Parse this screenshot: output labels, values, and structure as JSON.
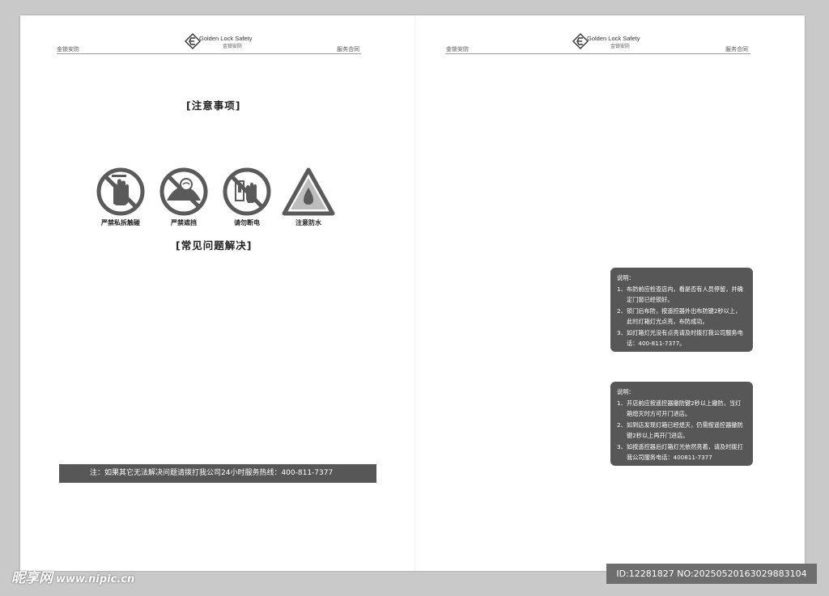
{
  "header": {
    "logo_en": "Golden Lock Safety",
    "logo_cn": "金锁安防",
    "left_text": "金锁安防",
    "right_text": "服务合同"
  },
  "left_page": {
    "notice_title": "[注意事项]",
    "signs": [
      {
        "label": "严禁私拆触碰",
        "icon": "no-touch-hand-icon"
      },
      {
        "label": "严禁遮挡",
        "icon": "no-cover-icon"
      },
      {
        "label": "请勿断电",
        "icon": "no-power-off-icon"
      },
      {
        "label": "注意防水",
        "icon": "waterproof-warning-icon"
      }
    ],
    "faq_title": "[常见问题解决]",
    "hotline_note": "注：如果其它无法解决问题请拨打我公司24小时服务热线：400-811-7377"
  },
  "right_page": {
    "box1": {
      "head": "说明：",
      "items": [
        {
          "num": "1、",
          "text": "布防前应检查店内，看是否有人员停留，并确定门窗已经锁好。"
        },
        {
          "num": "2、",
          "text": "锁门后布防，按遥控器外出布防键2秒以上，此时灯箱灯光点亮，布防成功。"
        },
        {
          "num": "3、",
          "text": "如灯箱灯光没有点亮请及时拨打我公司服务电话：400-811-7377。"
        }
      ]
    },
    "box2": {
      "head": "说明：",
      "items": [
        {
          "num": "1、",
          "text": "开店前应按遥控器撤防键2秒以上撤防，当灯箱熄灭时方可开门进店。"
        },
        {
          "num": "2、",
          "text": "如到店发现灯箱已经熄灭，仍需按遥控器撤防键2秒以上再开门进店。"
        },
        {
          "num": "3、",
          "text": "如按遥控器后灯箱灯光依然亮着，请及时拨打我公司服务电话：400811-7377"
        }
      ]
    }
  },
  "watermark": {
    "site_name": "昵享网",
    "url": "www.nipic.cn",
    "id_text": "ID:12281827 NO:20250520163029883104"
  },
  "colors": {
    "box_fill": "#575757",
    "sign_gray": "#5a5a5a",
    "page_bg": "#ffffff",
    "backdrop": "#c9c9c9"
  }
}
